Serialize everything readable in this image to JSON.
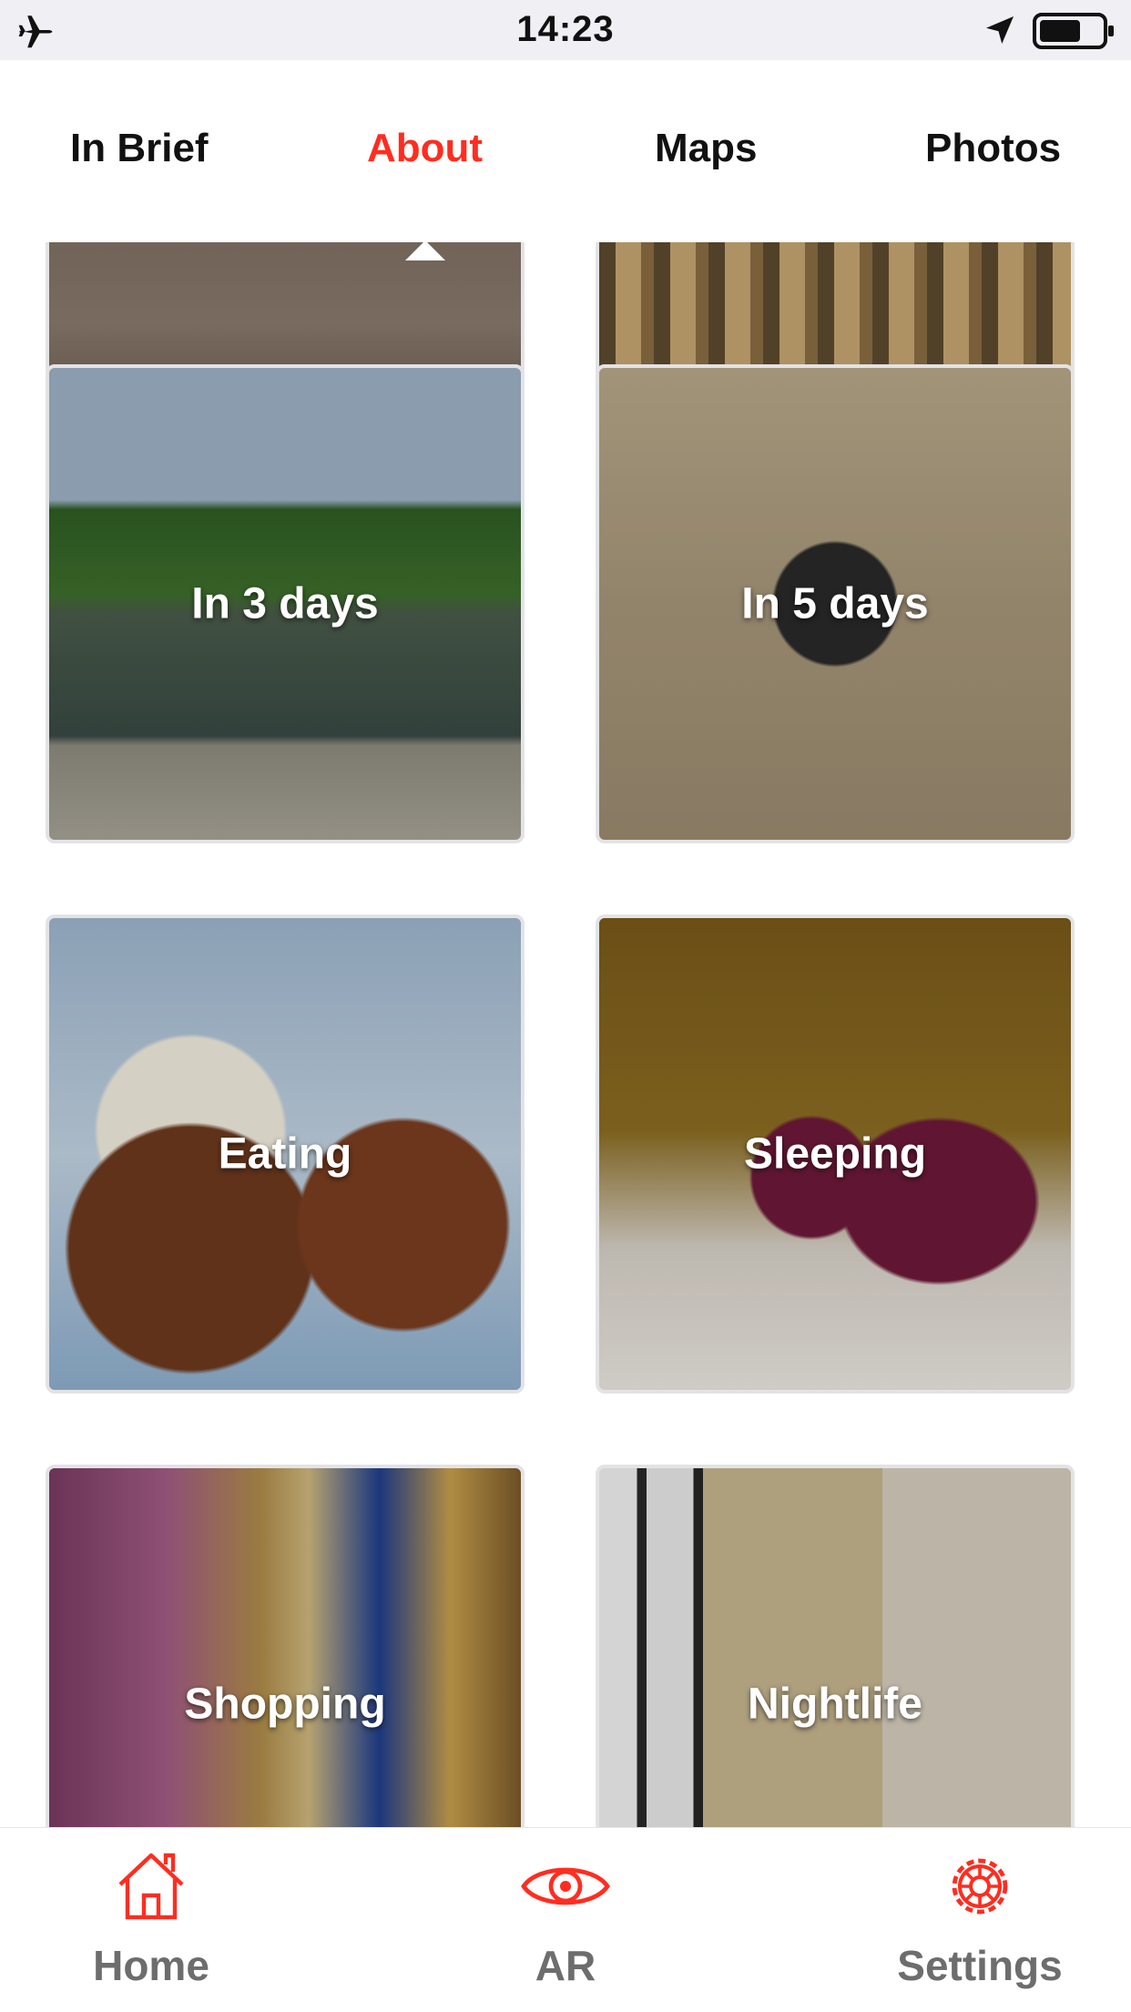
{
  "status_bar": {
    "time": "14:23",
    "icons": [
      "airplane-icon",
      "location-arrow-icon",
      "battery-icon"
    ]
  },
  "tabs": [
    {
      "label": "In Brief",
      "active": false
    },
    {
      "label": "About",
      "active": true
    },
    {
      "label": "Maps",
      "active": false
    },
    {
      "label": "Photos",
      "active": false
    }
  ],
  "colors": {
    "accent": "#ff2d20",
    "tab_text": "#111111",
    "bottom_label": "#6d6d6d",
    "card_border": "#e3e3e6"
  },
  "cards": [
    {
      "label": ""
    },
    {
      "label": ""
    },
    {
      "label": "In 3 days"
    },
    {
      "label": "In 5 days"
    },
    {
      "label": "Eating"
    },
    {
      "label": "Sleeping"
    },
    {
      "label": "Shopping"
    },
    {
      "label": "Nightlife"
    }
  ],
  "bottom_nav": [
    {
      "label": "Home",
      "icon": "home-icon"
    },
    {
      "label": "AR",
      "icon": "eye-icon"
    },
    {
      "label": "Settings",
      "icon": "gear-icon"
    }
  ]
}
